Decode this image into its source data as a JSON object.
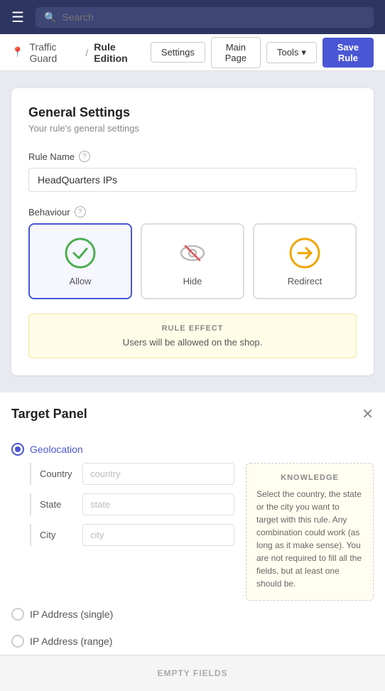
{
  "topbar": {
    "menu_icon": "☰",
    "search_placeholder": "Search"
  },
  "breadcrumb": {
    "icon": "📍",
    "parent": "Traffic Guard",
    "separator": "/",
    "current": "Rule Edition",
    "buttons": {
      "settings": "Settings",
      "main_page": "Main Page",
      "tools": "Tools",
      "tools_arrow": "▾",
      "save_rule": "Save Rule"
    }
  },
  "general_settings": {
    "title": "General Settings",
    "subtitle": "Your rule's general settings",
    "rule_name_label": "Rule Name",
    "rule_name_value": "HeadQuarters IPs",
    "behaviour_label": "Behaviour",
    "behaviours": [
      {
        "id": "allow",
        "label": "Allow",
        "selected": true
      },
      {
        "id": "hide",
        "label": "Hide",
        "selected": false
      },
      {
        "id": "redirect",
        "label": "Redirect",
        "selected": false
      }
    ],
    "rule_effect": {
      "title": "RULE EFFECT",
      "text": "Users will be allowed on the shop."
    }
  },
  "target_panel": {
    "title": "Target Panel",
    "close_icon": "✕",
    "options": [
      {
        "id": "geolocation",
        "label": "Geolocation",
        "selected": true
      },
      {
        "id": "ip_single",
        "label": "IP Address (single)",
        "selected": false
      },
      {
        "id": "ip_range",
        "label": "IP Address (range)",
        "selected": false
      }
    ],
    "geo_fields": [
      {
        "label": "Country",
        "placeholder": "country"
      },
      {
        "label": "State",
        "placeholder": "state"
      },
      {
        "label": "City",
        "placeholder": "city"
      }
    ],
    "knowledge": {
      "title": "KNOWLEDGE",
      "text": "Select the country, the state or the city you want to target with this rule. Any combination could work (as long as it make sense). You are not required to fill all the fields, but at least one should be."
    },
    "empty_fields_label": "EMPTY FIELDS"
  }
}
